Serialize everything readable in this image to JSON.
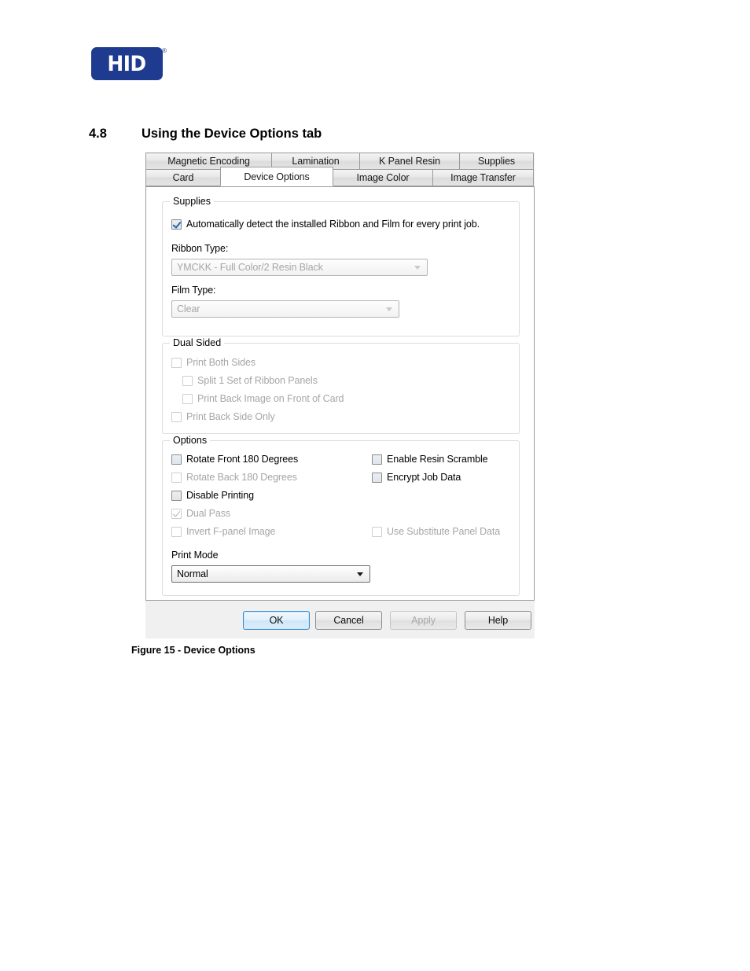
{
  "brand": {
    "logo_text": "HID",
    "registered_mark": "®",
    "logo_color": "#1f3b8f"
  },
  "section": {
    "number": "4.8",
    "title": "Using the Device Options tab"
  },
  "figure": {
    "caption": "Figure 15 - Device Options"
  },
  "dialog": {
    "tabs_row1": [
      {
        "label": "Magnetic Encoding",
        "selected": false
      },
      {
        "label": "Lamination",
        "selected": false
      },
      {
        "label": "K Panel Resin",
        "selected": false
      },
      {
        "label": "Supplies",
        "selected": false
      }
    ],
    "tabs_row2": [
      {
        "label": "Card",
        "selected": false
      },
      {
        "label": "Device Options",
        "selected": true
      },
      {
        "label": "Image Color",
        "selected": false
      },
      {
        "label": "Image Transfer",
        "selected": false
      }
    ],
    "supplies": {
      "legend": "Supplies",
      "auto_detect": {
        "label": "Automatically detect the installed Ribbon and Film for every print job.",
        "checked": true,
        "enabled": true
      },
      "ribbon_type_label": "Ribbon Type:",
      "ribbon_type_value": "YMCKK - Full Color/2 Resin Black",
      "ribbon_type_enabled": false,
      "film_type_label": "Film Type:",
      "film_type_value": "Clear",
      "film_type_enabled": false
    },
    "dual_sided": {
      "legend": "Dual Sided",
      "items": [
        {
          "label": "Print Both Sides",
          "checked": false,
          "enabled": false,
          "indent": 0
        },
        {
          "label": "Split 1 Set of Ribbon Panels",
          "checked": false,
          "enabled": false,
          "indent": 1
        },
        {
          "label": "Print Back Image on Front of Card",
          "checked": false,
          "enabled": false,
          "indent": 1
        },
        {
          "label": "Print Back Side Only",
          "checked": false,
          "enabled": false,
          "indent": 0
        }
      ]
    },
    "options": {
      "legend": "Options",
      "left_column": [
        {
          "label": "Rotate Front 180 Degrees",
          "checked": false,
          "enabled": true
        },
        {
          "label": "Rotate Back 180 Degrees",
          "checked": false,
          "enabled": false
        },
        {
          "label": "Disable Printing",
          "checked": false,
          "enabled": true
        },
        {
          "label": "Dual Pass",
          "checked": true,
          "enabled": false
        },
        {
          "label": "Invert F-panel Image",
          "checked": false,
          "enabled": false
        }
      ],
      "right_column": [
        {
          "label": "Enable Resin Scramble",
          "checked": false,
          "enabled": true
        },
        {
          "label": "Encrypt Job Data",
          "checked": false,
          "enabled": true
        },
        {
          "label": "Use Substitute Panel Data",
          "checked": false,
          "enabled": false
        }
      ],
      "print_mode_label": "Print Mode",
      "print_mode_value": "Normal",
      "print_mode_enabled": true
    },
    "buttons": [
      {
        "label": "OK",
        "default": true,
        "enabled": true
      },
      {
        "label": "Cancel",
        "default": false,
        "enabled": true
      },
      {
        "label": "Apply",
        "default": false,
        "enabled": false
      },
      {
        "label": "Help",
        "default": false,
        "enabled": true
      }
    ]
  }
}
